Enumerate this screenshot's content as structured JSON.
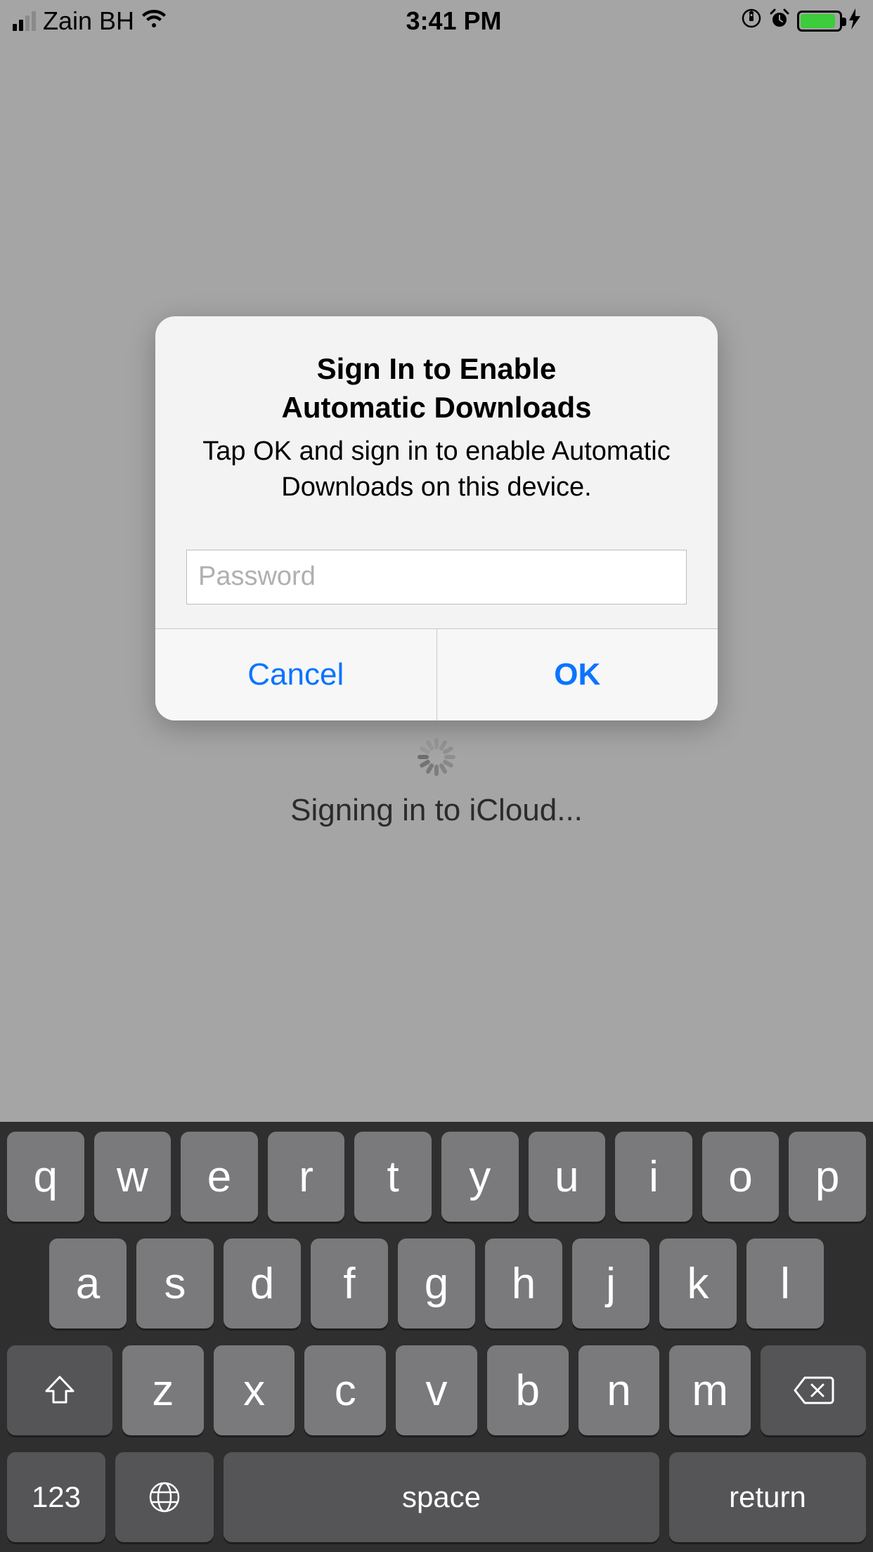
{
  "status_bar": {
    "carrier": "Zain BH",
    "time": "3:41 PM",
    "signal_active_bars": 2,
    "icons": {
      "wifi": "wifi",
      "orientation_lock": "orientation-lock",
      "alarm": "alarm",
      "bolt": "charging-bolt"
    }
  },
  "background": {
    "status_text": "Signing in to iCloud..."
  },
  "modal": {
    "title_line1": "Sign In to Enable",
    "title_line2": "Automatic Downloads",
    "message": "Tap OK and sign in to enable Automatic Downloads on this device.",
    "password_placeholder": "Password",
    "cancel_label": "Cancel",
    "ok_label": "OK"
  },
  "keyboard": {
    "row1": [
      "q",
      "w",
      "e",
      "r",
      "t",
      "y",
      "u",
      "i",
      "o",
      "p"
    ],
    "row2": [
      "a",
      "s",
      "d",
      "f",
      "g",
      "h",
      "j",
      "k",
      "l"
    ],
    "row3": [
      "z",
      "x",
      "c",
      "v",
      "b",
      "n",
      "m"
    ],
    "num_label": "123",
    "space_label": "space",
    "return_label": "return"
  }
}
